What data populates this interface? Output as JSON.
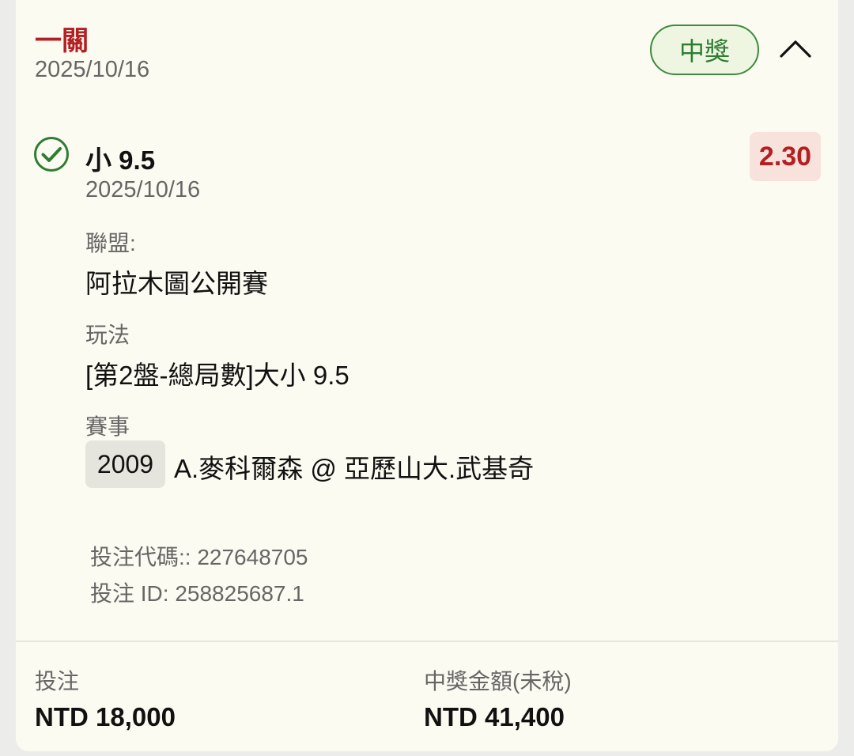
{
  "header": {
    "bet_type": "一關",
    "date": "2025/10/16",
    "status": "中獎"
  },
  "selection": {
    "name": "小 9.5",
    "date": "2025/10/16",
    "odds": "2.30",
    "league_label": "聯盟:",
    "league_value": "阿拉木圖公開賽",
    "market_label": "玩法",
    "market_value": "[第2盤-總局數]大小 9.5",
    "event_label": "賽事",
    "event_code": "2009",
    "event_name": "A.麥科爾森 @ 亞歷山大.武基奇"
  },
  "meta": {
    "bet_code": "投注代碼:: 227648705",
    "bet_id": "投注 ID: 258825687.1"
  },
  "footer": {
    "stake_label": "投注",
    "stake_value": "NTD 18,000",
    "payout_label": "中獎金額(未稅)",
    "payout_value": "NTD 41,400"
  },
  "colors": {
    "accent_red": "#b32024",
    "win_green": "#2e7d32",
    "card_bg": "#fcfbf2"
  }
}
